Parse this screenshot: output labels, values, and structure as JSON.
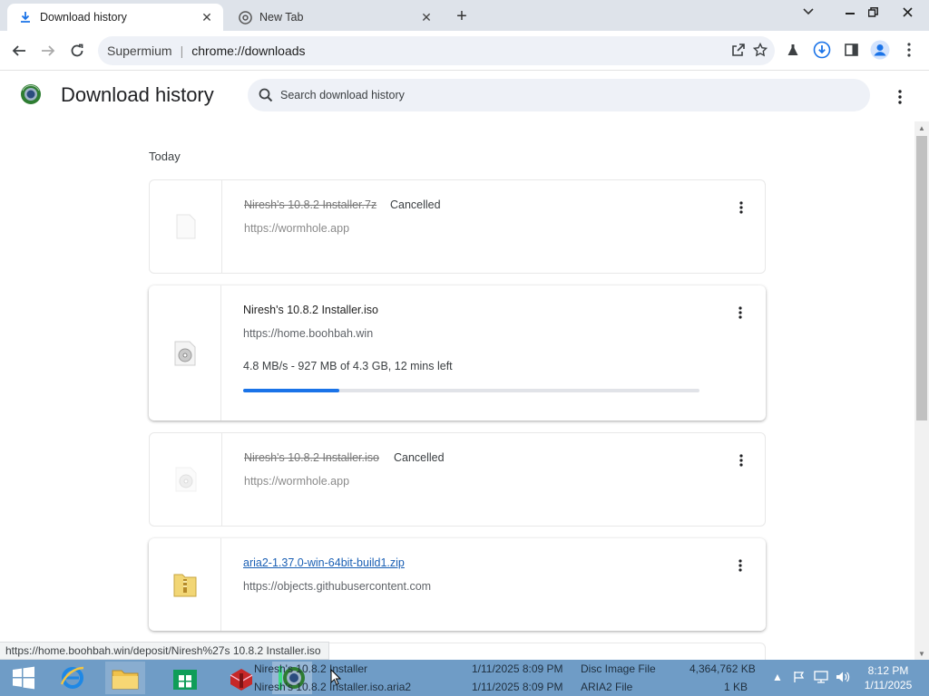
{
  "tabs": [
    {
      "label": "Download history",
      "icon": "download-icon"
    },
    {
      "label": "New Tab",
      "icon": "chrome-icon"
    }
  ],
  "omnibox": {
    "host": "Supermium",
    "url": "chrome://downloads"
  },
  "page": {
    "title": "Download history",
    "search_placeholder": "Search download history"
  },
  "downloads": {
    "day_label": "Today",
    "items": [
      {
        "name": "Niresh's 10.8.2 Installer.7z",
        "status": "Cancelled",
        "url": "https://wormhole.app",
        "state": "cancelled"
      },
      {
        "name": "Niresh's 10.8.2 Installer.iso",
        "url": "https://home.boohbah.win",
        "progress_text": "4.8 MB/s - 927 MB of 4.3 GB, 12 mins left",
        "progress_fraction": 0.21,
        "state": "in-progress"
      },
      {
        "name": "Niresh's 10.8.2 Installer.iso",
        "status": "Cancelled",
        "url": "https://wormhole.app",
        "state": "cancelled"
      },
      {
        "name": "aria2-1.37.0-win-64bit-build1.zip",
        "url": "https://objects.githubusercontent.com",
        "state": "complete"
      }
    ]
  },
  "status_bar": {
    "text": "https://home.boohbah.win/deposit/Niresh%27s 10.8.2 Installer.iso"
  },
  "taskbar": {
    "rows": [
      {
        "name": "Niresh's 10.8.2 Installer",
        "date": "1/11/2025 8:09 PM",
        "type": "Disc Image File",
        "size": "4,364,762 KB"
      },
      {
        "name": "Niresh's 10.8.2 Installer.iso.aria2",
        "date": "1/11/2025 8:09 PM",
        "type": "ARIA2 File",
        "size": "1 KB"
      }
    ],
    "clock_time": "8:12 PM",
    "clock_date": "1/11/2025"
  },
  "colors": {
    "accent": "#1a73e8",
    "taskbar": "#6f9cc6",
    "link": "#1a5fb4"
  }
}
